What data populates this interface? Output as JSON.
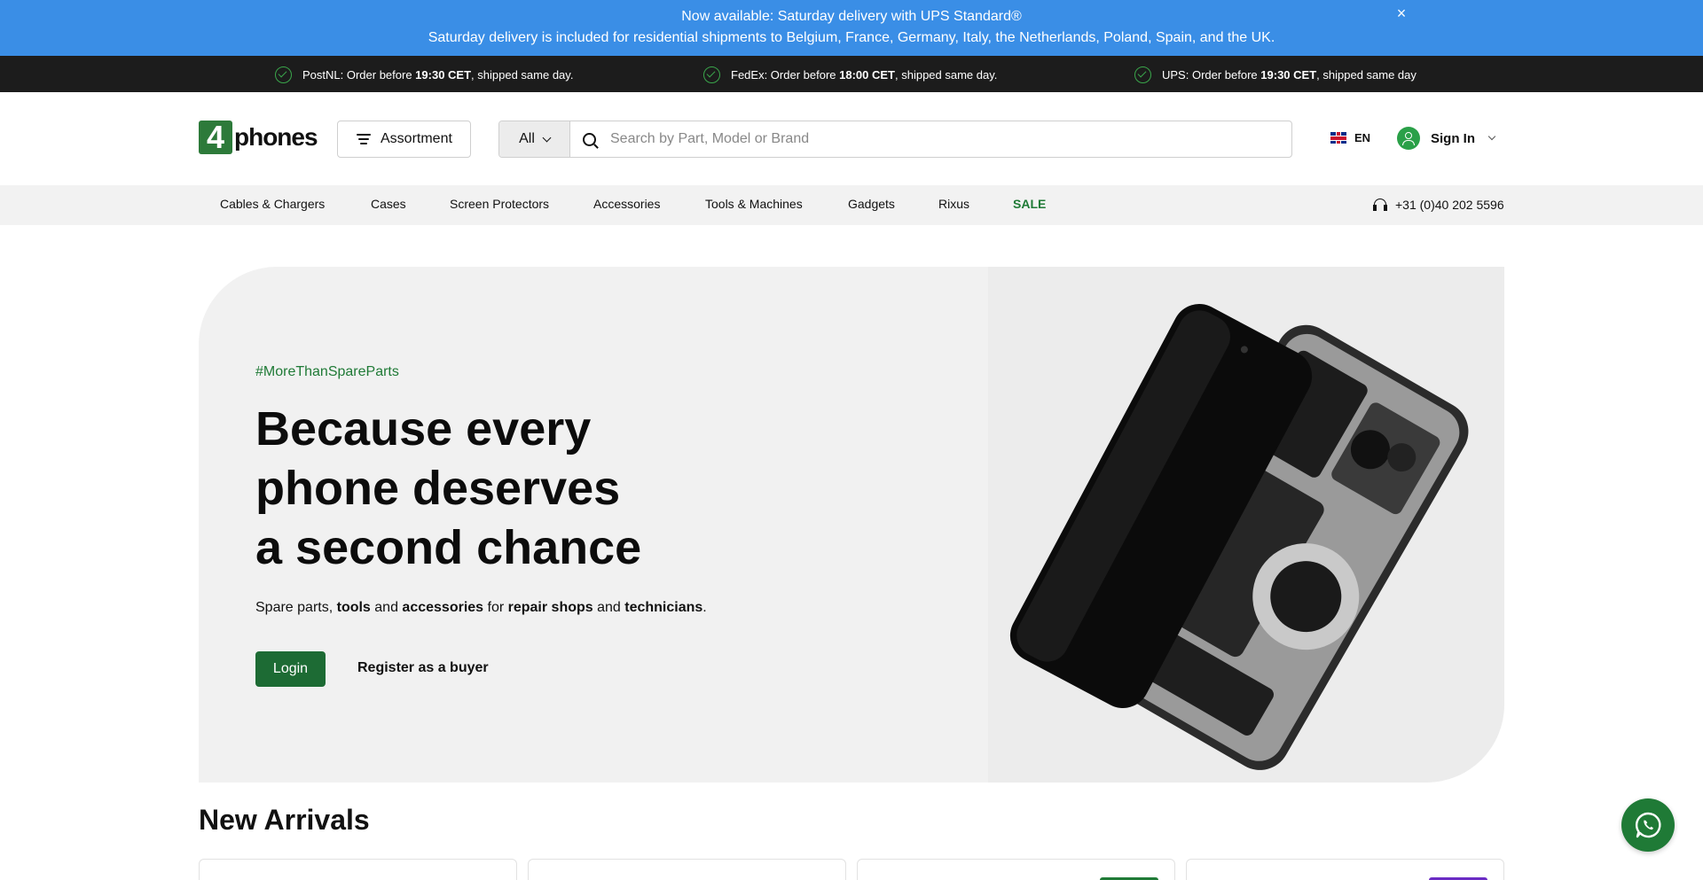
{
  "announcement": {
    "line1": "Now available: Saturday delivery with UPS Standard®",
    "line2": "Saturday delivery is included for residential shipments to Belgium, France, Germany, Italy, the Netherlands, Poland, Spain, and the UK.",
    "close_label": "×"
  },
  "shipping": [
    {
      "prefix": "PostNL: Order before ",
      "time": "19:30 CET",
      "suffix": ", shipped same day."
    },
    {
      "prefix": "FedEx: Order before ",
      "time": "18:00 CET",
      "suffix": ", shipped same day."
    },
    {
      "prefix": "UPS: Order before ",
      "time": "19:30 CET",
      "suffix": ", shipped same day"
    }
  ],
  "header": {
    "logo_digit": "4",
    "logo_word": "phones",
    "assortment_label": "Assortment",
    "search_category": "All",
    "search_placeholder": "Search by Part, Model or Brand",
    "language": "EN",
    "sign_in": "Sign In"
  },
  "nav": {
    "items": [
      "Cables & Chargers",
      "Cases",
      "Screen Protectors",
      "Accessories",
      "Tools & Machines",
      "Gadgets",
      "Rixus",
      "SALE"
    ],
    "phone": "+31 (0)40 202 5596"
  },
  "hero": {
    "tag": "#MoreThanSpareParts",
    "headline": [
      "Because every",
      "phone deserves",
      "a second chance"
    ],
    "sub": {
      "t1": "Spare parts, ",
      "b1": "tools",
      "t2": " and ",
      "b2": "accessories",
      "t3": " for ",
      "b3": "repair shops",
      "t4": " and ",
      "b4": "technicians",
      "t5": "."
    },
    "login_label": "Login",
    "register_label": "Register as a buyer"
  },
  "new_arrivals": {
    "title": "New Arrivals",
    "badge_colors": [
      "",
      "",
      "#1f7a36",
      "#6a2bc4"
    ]
  },
  "colors": {
    "announcement_bg": "#3a8ee6",
    "brand_green": "#1f7a36",
    "shipbar_bg": "#1c1c1c"
  }
}
